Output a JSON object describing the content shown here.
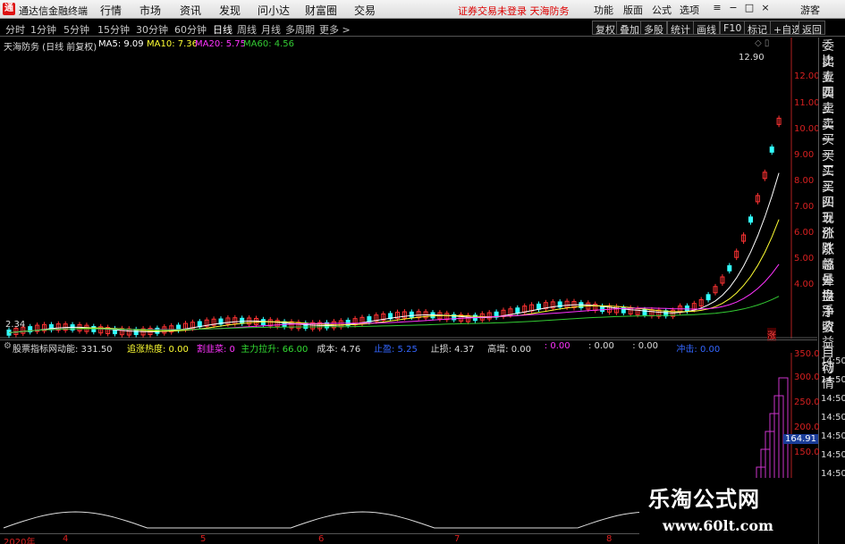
{
  "menubar": {
    "app_title": "通达信金融终端",
    "menus": [
      "行情",
      "市场",
      "资讯",
      "发现",
      "问小达",
      "财富圈",
      "交易"
    ],
    "warning": "证券交易未登录  天海防务",
    "right_items": [
      "功能",
      "版面",
      "公式",
      "选项"
    ],
    "login": "游客"
  },
  "toolbar": {
    "periods": [
      "分时",
      "1分钟",
      "5分钟",
      "15分钟",
      "30分钟",
      "60分钟",
      "日线",
      "周线",
      "月线",
      "多周期",
      "更多 >"
    ],
    "active_period": "日线",
    "right_buttons": [
      "复权",
      "叠加",
      "多股",
      "统计",
      "画线",
      "F10",
      "标记",
      "+自选",
      "返回"
    ]
  },
  "main_chart": {
    "stock_label": "天海防务 (日线 前复权)",
    "ma5": "MA5: 9.09",
    "ma10": "MA10: 7.36",
    "ma20": "MA20: 5.75",
    "ma60": "MA60: 4.56",
    "high_label": "12.90",
    "low_label": "2.34",
    "price_ticks": [
      "12.00",
      "11.00",
      "10.00",
      "9.00",
      "8.00",
      "7.00",
      "6.00",
      "5.00",
      "4.00"
    ],
    "limit_marker": "涨",
    "colors": {
      "ma5": "#ffffff",
      "ma10": "#ffff33",
      "ma20": "#ff33ff",
      "ma60": "#33cc33",
      "up": "#ff3333",
      "down": "#33ffff"
    }
  },
  "right_panel": {
    "items": [
      "委比",
      "卖五",
      "卖四",
      "卖三",
      "卖二",
      "卖一",
      "买一",
      "买二",
      "买三",
      "买四",
      "买五",
      "现价",
      "涨跌",
      "涨幅",
      "总量",
      "外盘",
      "换手",
      "净资",
      "收益"
    ],
    "items2": [
      "自动",
      "行情"
    ]
  },
  "sub_indicator": {
    "name": "股票指标网",
    "items": [
      {
        "text": "动能: 331.50",
        "color": "#dddddd"
      },
      {
        "text": "追涨热度: 0.00",
        "color": "#ffff33"
      },
      {
        "text": "割韭菜: 0",
        "color": "#ff33ff"
      },
      {
        "text": "主力拉升: 66.00",
        "color": "#33dd33"
      },
      {
        "text": "成本: 4.76",
        "color": "#dddddd"
      },
      {
        "text": "止盈: 5.25",
        "color": "#3366ff"
      },
      {
        "text": "止损: 4.37",
        "color": "#dddddd"
      },
      {
        "text": "高增: 0.00",
        "color": "#dddddd"
      },
      {
        "text": ": 0.00",
        "color": "#ff33ff"
      },
      {
        "text": ": 0.00",
        "color": "#dddddd"
      },
      {
        "text": ": 0.00",
        "color": "#dddddd"
      },
      {
        "text": "冲击: 0.00",
        "color": "#3366ff"
      }
    ],
    "ticks": [
      "350.0",
      "300.0",
      "250.0",
      "200.0",
      "150.0"
    ],
    "time_ticks": [
      "14:50",
      "14:50",
      "14:50",
      "14:50",
      "14:50",
      "14:50",
      "14:50"
    ],
    "current_value": "164.91"
  },
  "date_axis": [
    "2020年",
    "4",
    "5",
    "6",
    "7",
    "8"
  ],
  "watermark": {
    "title": "乐淘公式网",
    "url": "www.60lt.com"
  }
}
